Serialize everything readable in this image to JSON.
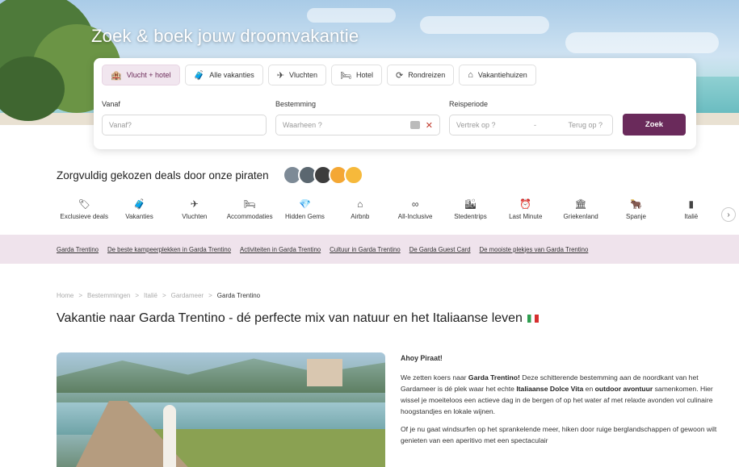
{
  "hero": {
    "title": "Zoek & boek jouw droomvakantie"
  },
  "search": {
    "tabs": [
      {
        "label": "Vlucht + hotel",
        "icon": "flight-hotel-icon",
        "glyph": "🏨"
      },
      {
        "label": "Alle vakanties",
        "icon": "suitcase-icon",
        "glyph": "🧳"
      },
      {
        "label": "Vluchten",
        "icon": "plane-icon",
        "glyph": "✈"
      },
      {
        "label": "Hotel",
        "icon": "bed-icon",
        "glyph": "🛏"
      },
      {
        "label": "Rondreizen",
        "icon": "route-icon",
        "glyph": "⟳"
      },
      {
        "label": "Vakantiehuizen",
        "icon": "house-icon",
        "glyph": "⌂"
      }
    ],
    "from_label": "Vanaf",
    "from_placeholder": "Vanaf?",
    "destination_label": "Bestemming",
    "destination_placeholder": "Waarheen ?",
    "period_label": "Reisperiode",
    "depart_placeholder": "Vertrek op ?",
    "separator": "-",
    "return_placeholder": "Terug op ?",
    "submit_label": "Zoek",
    "accent": "#6a2a5b"
  },
  "curated": {
    "title": "Zorgvuldig gekozen deals door onze piraten"
  },
  "categories": [
    {
      "label": "Exclusieve deals",
      "icon": "tag-icon",
      "glyph": "🏷"
    },
    {
      "label": "Vakanties",
      "icon": "suitcase-icon",
      "glyph": "🧳"
    },
    {
      "label": "Vluchten",
      "icon": "plane-icon",
      "glyph": "✈"
    },
    {
      "label": "Accommodaties",
      "icon": "bed-icon",
      "glyph": "🛏"
    },
    {
      "label": "Hidden Gems",
      "icon": "gem-icon",
      "glyph": "💎"
    },
    {
      "label": "Airbnb",
      "icon": "house-icon",
      "glyph": "⌂"
    },
    {
      "label": "All-Inclusive",
      "icon": "infinity-icon",
      "glyph": "∞"
    },
    {
      "label": "Stedentrips",
      "icon": "city-icon",
      "glyph": "🏙"
    },
    {
      "label": "Last Minute",
      "icon": "alarm-clock-icon",
      "glyph": "⏰"
    },
    {
      "label": "Griekenland",
      "icon": "temple-icon",
      "glyph": "🏛"
    },
    {
      "label": "Spanje",
      "icon": "bull-icon",
      "glyph": "🐂"
    },
    {
      "label": "Italië",
      "icon": "italy-icon",
      "glyph": "▮"
    }
  ],
  "topics": [
    "Garda Trentino",
    "De beste kampeerplekken in Garda Trentino",
    "Activiteiten in Garda Trentino",
    "Cultuur in Garda Trentino",
    "De Garda Guest Card",
    "De mooiste plekjes van Garda Trentino"
  ],
  "breadcrumb": {
    "items": [
      "Home",
      "Bestemmingen",
      "Italië",
      "Gardameer"
    ],
    "separator": ">",
    "current": "Garda Trentino"
  },
  "page": {
    "title": "Vakantie naar Garda Trentino - dé perfecte mix van natuur en het Italiaanse leven"
  },
  "article": {
    "greeting": "Ahoy Piraat!",
    "p1_a": "We zetten koers naar ",
    "p1_b": "Garda Trentino!",
    "p1_c": " Deze schitterende bestemming aan de noordkant van het Gardameer is dé plek waar het echte ",
    "p1_d": "Italiaanse Dolce Vita",
    "p1_e": " en ",
    "p1_f": "outdoor avontuur",
    "p1_g": " samenkomen. Hier wissel je moeiteloos een actieve dag in de bergen of op het water af met relaxte avonden vol culinaire hoogstandjes en lokale wijnen.",
    "p2": "Of je nu gaat windsurfen op het sprankelende meer, hiken door ruige berglandschappen of gewoon wilt genieten van een aperitivo met een spectaculair"
  }
}
